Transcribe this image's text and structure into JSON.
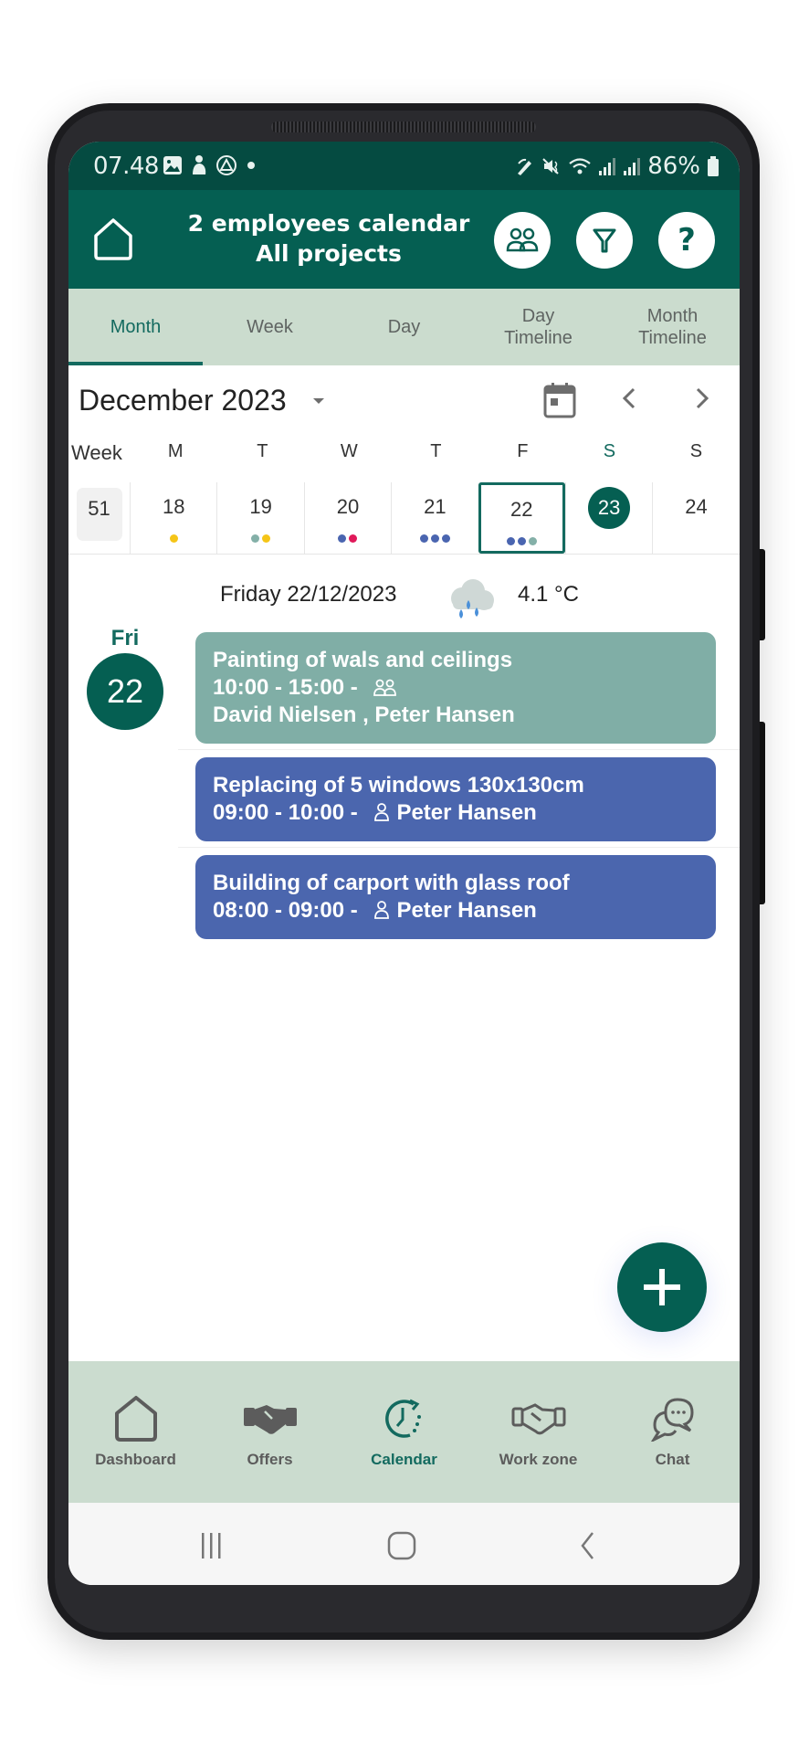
{
  "status_bar": {
    "time": "07.48",
    "left_icons": [
      "gallery-icon",
      "app-notification-icon",
      "drive-icon",
      "dot-icon"
    ],
    "right_icons": [
      "pen-icon",
      "mute-icon",
      "wifi-icon",
      "signal-icon",
      "signal-icon"
    ],
    "battery": "86%"
  },
  "header": {
    "title_line1": "2 employees calendar",
    "title_line2": "All projects",
    "buttons": [
      "employees-icon",
      "filter-icon",
      "help-icon"
    ]
  },
  "tabs": [
    {
      "label": "Month",
      "active": true
    },
    {
      "label": "Week",
      "active": false
    },
    {
      "label": "Day",
      "active": false
    },
    {
      "label": "Day\nTimeline",
      "active": false
    },
    {
      "label": "Month\nTimeline",
      "active": false
    }
  ],
  "calendar": {
    "month_label": "December 2023",
    "week_header": "Week",
    "weekdays": [
      "M",
      "T",
      "W",
      "T",
      "F",
      "S",
      "S"
    ],
    "week_number": "51",
    "days": [
      {
        "num": "18",
        "dots": [
          "#f5c518"
        ]
      },
      {
        "num": "19",
        "dots": [
          "#84b0a8",
          "#f5c518"
        ]
      },
      {
        "num": "20",
        "dots": [
          "#4a65b0",
          "#e0195a"
        ]
      },
      {
        "num": "21",
        "dots": [
          "#4a65b0",
          "#4a65b0",
          "#4a65b0"
        ]
      },
      {
        "num": "22",
        "dots": [
          "#4a65b0",
          "#4a65b0",
          "#84b0a8"
        ],
        "selected": true
      },
      {
        "num": "23",
        "dots": [],
        "today": true
      },
      {
        "num": "24",
        "dots": []
      }
    ]
  },
  "day_view": {
    "date_label": "Friday 22/12/2023",
    "weather_icon": "rain-cloud-icon",
    "temperature": "4.1 °C",
    "day_name": "Fri",
    "day_number": "22",
    "events": [
      {
        "title": "Painting of wals and ceilings",
        "time": "10:00 - 15:00 -",
        "assignee_icon": "group-icon",
        "assignees_line": "David Nielsen , Peter Hansen",
        "color": "#80aea6"
      },
      {
        "title": "Replacing of 5 windows 130x130cm",
        "time": "09:00 - 10:00 -",
        "assignee_icon": "person-icon",
        "assignees_inline": "Peter Hansen",
        "color": "#4b66ae"
      },
      {
        "title": "Building of carport with glass roof",
        "time": "08:00 - 09:00 -",
        "assignee_icon": "person-icon",
        "assignees_inline": "Peter Hansen",
        "color": "#4b66ae"
      }
    ]
  },
  "fab": {
    "icon": "plus-icon"
  },
  "bottom_nav": [
    {
      "label": "Dashboard",
      "icon": "home-icon",
      "active": false
    },
    {
      "label": "Offers",
      "icon": "handshake-icon",
      "active": false
    },
    {
      "label": "Calendar",
      "icon": "calendar-clock-icon",
      "active": true
    },
    {
      "label": "Work zone",
      "icon": "handshake-outline-icon",
      "active": false
    },
    {
      "label": "Chat",
      "icon": "chat-icon",
      "active": false
    }
  ],
  "colors": {
    "primary": "#055f52",
    "status_bar": "#054b41",
    "tab_bg": "#cbdcce",
    "accent_text": "#136a5f",
    "event_teal": "#80aea6",
    "event_blue": "#4b66ae"
  }
}
